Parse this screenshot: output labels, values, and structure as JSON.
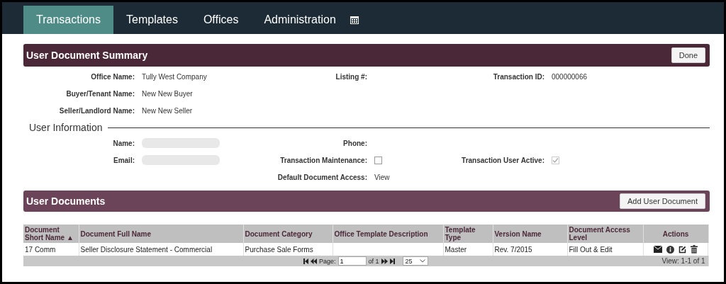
{
  "nav": {
    "tabs": [
      {
        "label": "Transactions",
        "selected": true
      },
      {
        "label": "Templates",
        "selected": false
      },
      {
        "label": "Offices",
        "selected": false
      },
      {
        "label": "Administration",
        "selected": false
      }
    ]
  },
  "summary": {
    "title": "User Document Summary",
    "done_button": "Done",
    "rows": [
      [
        {
          "label": "Office Name:",
          "value": "Tully West Company"
        },
        {
          "label": "Listing #:"
        },
        {
          "label": "Transaction ID:",
          "value": "000000066"
        }
      ],
      [
        {
          "label": "Buyer/Tenant Name:",
          "value": "New New Buyer"
        }
      ],
      [
        {
          "label": "Seller/Landlord Name:",
          "value": "New New Seller"
        }
      ]
    ]
  },
  "user_information": {
    "heading": "User Information",
    "fields": [
      {
        "kind": "blurred",
        "label": "Name:"
      },
      {
        "kind": "text",
        "label": "Phone:"
      },
      {
        "kind": "empty"
      },
      {
        "kind": "blurred",
        "label": "Email:"
      },
      {
        "kind": "checkbox",
        "label": "Transaction Maintenance:",
        "checked": false,
        "disabled": false
      },
      {
        "kind": "checkbox",
        "label": "Transaction User Active:",
        "checked": true,
        "disabled": true
      },
      {
        "kind": "empty"
      },
      {
        "kind": "text",
        "label": "Default Document Access:",
        "value": "View"
      },
      {
        "kind": "empty"
      }
    ]
  },
  "user_documents": {
    "title": "User Documents",
    "add_button": "Add User Document",
    "table": {
      "columns": [
        "Document Short Name ▲",
        "Document Full Name",
        "Document Category",
        "Office Template Description",
        "Template Type",
        "Version Name",
        "Document Access Level",
        "Actions"
      ],
      "rows": [
        [
          "17 Comm",
          "Seller Disclosure Statement - Commercial",
          "Purchase Sale Forms",
          "",
          "Master",
          "Rev. 7/2015",
          "Fill Out & Edit"
        ]
      ]
    },
    "pager": {
      "page_label": "Page:",
      "page": "1",
      "of_label": "of 1",
      "page_size": "25",
      "view": "View: 1-1 of 1"
    }
  }
}
